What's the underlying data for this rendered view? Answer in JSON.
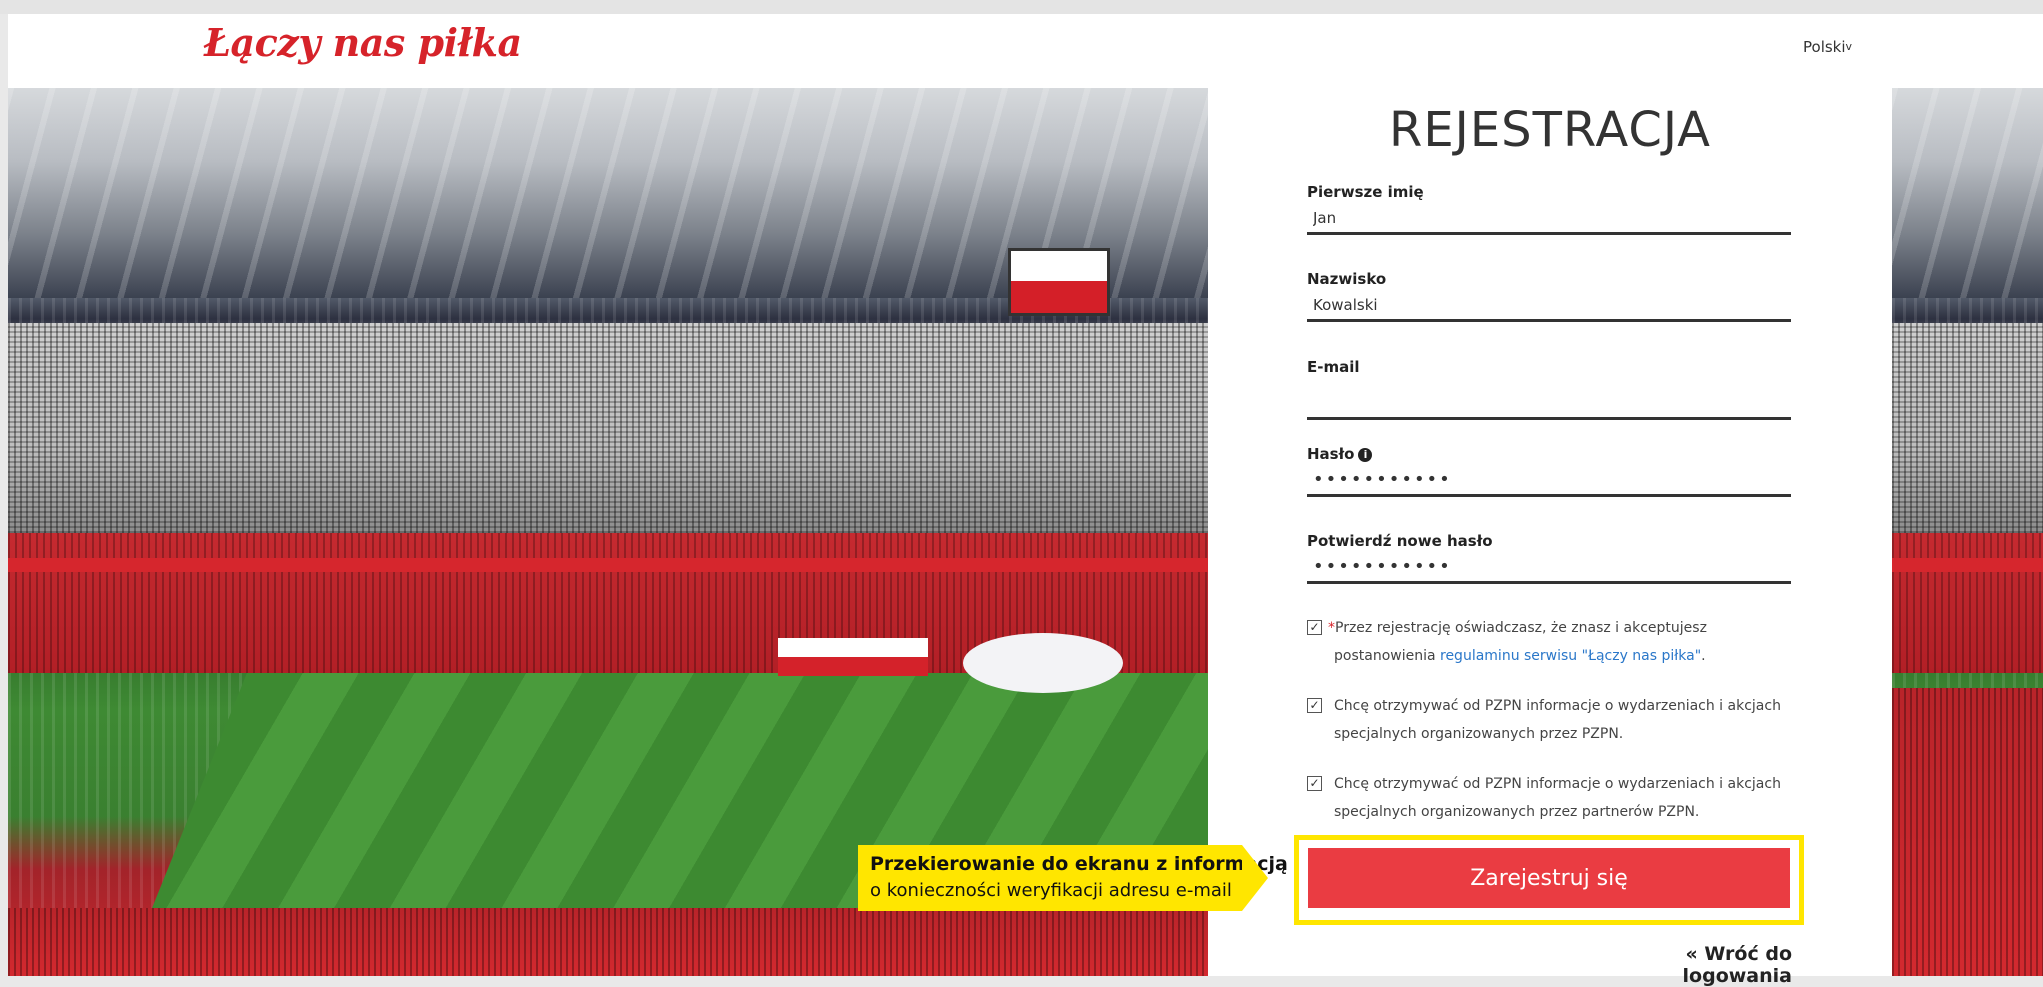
{
  "header": {
    "logo": "Łączy nas piłka",
    "language": "Polski",
    "language_caret": "v"
  },
  "form": {
    "title": "REJESTRACJA",
    "first_name": {
      "label": "Pierwsze imię",
      "value": "Jan"
    },
    "last_name": {
      "label": "Nazwisko",
      "value": "Kowalski"
    },
    "email": {
      "label": "E-mail",
      "value": ""
    },
    "password": {
      "label": "Hasło",
      "value": "•••••••••••",
      "info_icon": "info-icon"
    },
    "confirm_password": {
      "label": "Potwierdź nowe hasło",
      "value": "•••••••••••"
    },
    "terms": {
      "required_mark": "*",
      "text": "Przez rejestrację oświadczasz, że znasz i akceptujesz postanowienia ",
      "link": "regulaminu serwisu \"Łączy nas piłka\"",
      "end": ".",
      "checked": true
    },
    "consent_pzpn": {
      "text": "Chcę otrzymywać od PZPN informacje o wydarzeniach i akcjach specjalnych organizowanych przez PZPN.",
      "checked": true
    },
    "consent_partners": {
      "text": "Chcę otrzymywać od PZPN informacje o wydarzeniach i akcjach specjalnych organizowanych przez partnerów PZPN.",
      "checked": true
    },
    "submit_label": "Zarejestruj się",
    "back_link": "« Wróć do logowania"
  },
  "callout": {
    "line1": "Przekierowanie do ekranu z informacją",
    "line2": "o konieczności weryfikacji adresu e-mail"
  },
  "colors": {
    "brand_red": "#d6232a",
    "button_red": "#ea3c42",
    "callout_yellow": "#ffe600",
    "link_blue": "#2a77c9"
  }
}
